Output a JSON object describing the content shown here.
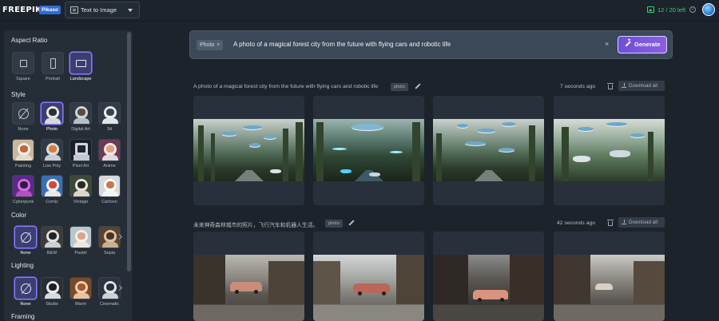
{
  "topbar": {
    "logo": "FREEPIK",
    "badge": "Pikaso",
    "mode_label": "Text to Image",
    "credits": "12 / 20 left"
  },
  "sidebar": {
    "aspect_ratio": {
      "title": "Aspect Ratio",
      "options": [
        "Square",
        "Portrait",
        "Landscape"
      ],
      "selected": "Landscape"
    },
    "style": {
      "title": "Style",
      "options": [
        "None",
        "Photo",
        "Digital Art",
        "3d",
        "Painting",
        "Low Poly",
        "Pixel Art",
        "Anime",
        "Cyberpunk",
        "Comic",
        "Vintage",
        "Cartoon"
      ],
      "selected": "Photo"
    },
    "color": {
      "title": "Color",
      "options": [
        "None",
        "B&W",
        "Pastel",
        "Sepia"
      ],
      "selected": "None"
    },
    "lighting": {
      "title": "Lighting",
      "options": [
        "None",
        "Studio",
        "Warm",
        "Cinematic"
      ],
      "selected": "None"
    },
    "framing": {
      "title": "Framing"
    }
  },
  "prompt": {
    "chip_label": "Photo",
    "chip_close": "×",
    "text": "A photo of a magical forest city from the future with flying cars and robotic life",
    "clear": "×",
    "generate_label": "Generate"
  },
  "generations": [
    {
      "prompt": "A photo of a magical forest city from the future with flying cars and robotic life",
      "tag": "photo",
      "time": "7 seconds ago",
      "download_label": "Download all"
    },
    {
      "prompt": "未来神奇森林城市的照片，飞行汽车和机器人生活。",
      "tag": "photo",
      "time": "42 seconds ago",
      "download_label": "Download all"
    }
  ],
  "colors": {
    "accent": "#7b5ce0",
    "credits": "#3ccf7a",
    "background": "#1c232b"
  }
}
